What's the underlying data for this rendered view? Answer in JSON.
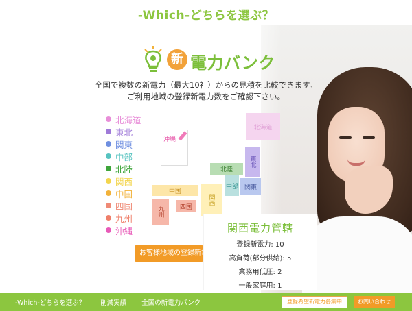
{
  "header": {
    "title": "-Which-どちらを選ぶ？"
  },
  "logo": {
    "circle_char": "新",
    "text": "電力バンク"
  },
  "intro": {
    "line1": "全国で複数の新電力（最大10社）からの見積を比較できます。",
    "line2": "ご利用地域の登録新電力数をご確認下さい。"
  },
  "legend": [
    {
      "label": "北海道",
      "color": "#e88ed8"
    },
    {
      "label": "東北",
      "color": "#9f7ad8"
    },
    {
      "label": "関東",
      "color": "#6f8fe0"
    },
    {
      "label": "中部",
      "color": "#57c3c0"
    },
    {
      "label": "北陸",
      "color": "#3ea53a"
    },
    {
      "label": "関西",
      "color": "#f3d54e"
    },
    {
      "label": "中国",
      "color": "#f2b23a"
    },
    {
      "label": "四国",
      "color": "#ef8a76"
    },
    {
      "label": "九州",
      "color": "#ef7f6a"
    },
    {
      "label": "沖縄",
      "color": "#e85ab8"
    }
  ],
  "map": {
    "hokkaido": "北海道",
    "tohoku": "東北",
    "kanto": "関東",
    "hokuriku": "北陸",
    "chubu": "中部",
    "kinki": "関西",
    "chugoku": "中国",
    "shikoku": "四国",
    "kyushu": "九州",
    "okinawa": "沖縄"
  },
  "info": {
    "title": "関西電力管轄",
    "rows": [
      "登録新電力: 10",
      "高負荷(部分供給): 5",
      "業務用低圧: 2",
      "一般家庭用: 1"
    ]
  },
  "cta": {
    "label": "お客様地域の登録新電力"
  },
  "footer": {
    "links": [
      "-Which-どちらを選ぶ？",
      "削減実績",
      "全国の新電力バンク"
    ],
    "entry_button": "登録希望新電力募集中",
    "contact_button": "お問い合わせ"
  }
}
